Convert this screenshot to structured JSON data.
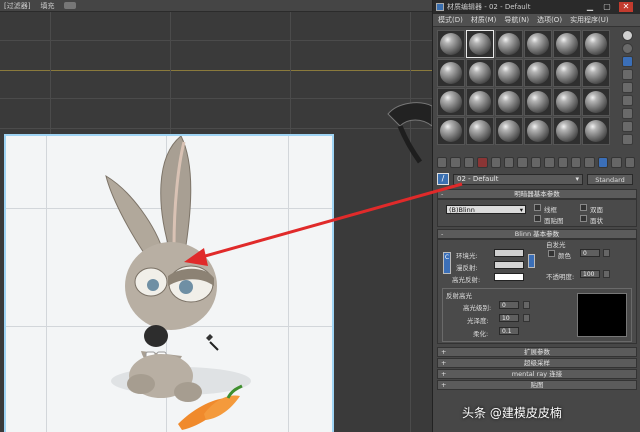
{
  "topbar": {
    "items": [
      "[过滤器]",
      "填充"
    ]
  },
  "material_editor": {
    "title": "材质编辑器 - 02 - Default",
    "menu": [
      "模式(D)",
      "材质(M)",
      "导航(N)",
      "选项(O)",
      "实用程序(U)"
    ],
    "slot_count": 24,
    "selected_slot": 1,
    "material_name": "02 - Default",
    "material_type": "Standard",
    "shader_rollout": "明暗器基本参数",
    "shader_value": "(B)Blinn",
    "shader_options": [
      "线框",
      "双面",
      "面贴图",
      "面状"
    ],
    "blinn_rollout": "Blinn 基本参数",
    "self_illum_label": "自发光",
    "color_label": "颜色",
    "color_value": "0",
    "ambient_label": "环境光:",
    "diffuse_label": "漫反射:",
    "specular_label": "高光反射:",
    "opacity_label": "不透明度:",
    "opacity_value": "100",
    "lock_label": "C",
    "specular_highlights_label": "反射高光",
    "specular_level_label": "高光级别:",
    "specular_level_value": "0",
    "glossiness_label": "光泽度:",
    "glossiness_value": "10",
    "soften_label": "柔化:",
    "soften_value": "0.1",
    "extra_rollouts": [
      "扩展参数",
      "超级采样",
      "mental ray 连接",
      "贴图"
    ]
  },
  "watermark": "头条 @建模皮皮楠",
  "colors": {
    "accent_arrow": "#e02a2a",
    "selection_border": "#9fd4f4"
  }
}
